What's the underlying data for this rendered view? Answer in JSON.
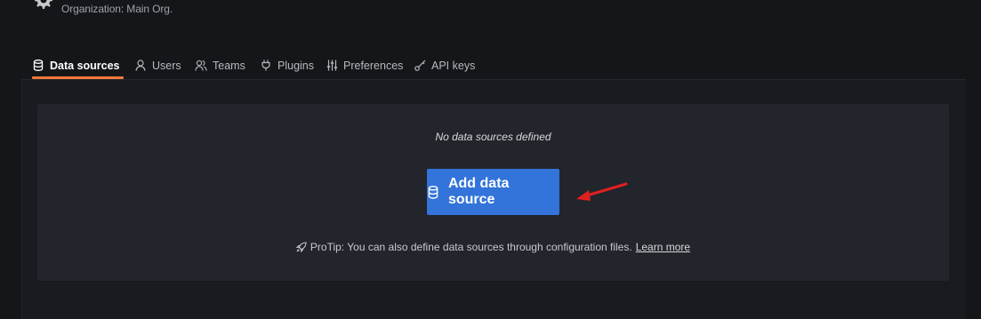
{
  "header": {
    "org_icon": "gear-icon",
    "subtitle": "Organization: Main Org."
  },
  "tabs": [
    {
      "label": "Data sources",
      "icon": "database-icon",
      "active": true
    },
    {
      "label": "Users",
      "icon": "user-icon",
      "active": false
    },
    {
      "label": "Teams",
      "icon": "users-icon",
      "active": false
    },
    {
      "label": "Plugins",
      "icon": "plug-icon",
      "active": false
    },
    {
      "label": "Preferences",
      "icon": "sliders-icon",
      "active": false
    },
    {
      "label": "API keys",
      "icon": "key-icon",
      "active": false
    }
  ],
  "empty_state": {
    "title": "No data sources defined",
    "button_label": "Add data source",
    "button_icon": "database-icon",
    "protip_icon": "rocket-icon",
    "protip_text": "ProTip: You can also define data sources through configuration files.",
    "learn_more": "Learn more"
  },
  "annotation": {
    "arrow_color": "#e02020"
  },
  "colors": {
    "background": "#141619",
    "panel": "#22252b",
    "accent_tab": "#f5793a",
    "primary_button": "#3274d9"
  }
}
